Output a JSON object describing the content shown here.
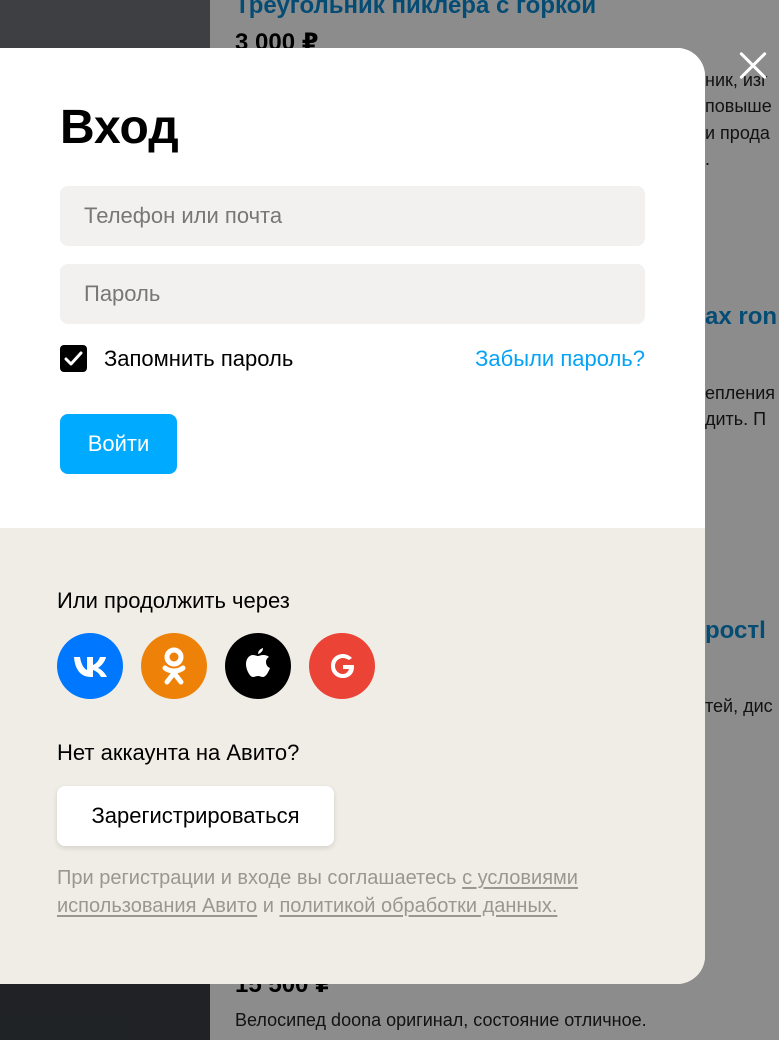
{
  "background": {
    "listing_top_title": "Треугольник пиклера с горкой",
    "listing_top_price": "3 000 ₽",
    "fragments": [
      "ник, изг",
      "повыше",
      "и прода",
      "."
    ],
    "listing2_title_fragment": "ax ron",
    "listing2_desc_fragments": [
      "епления",
      "дить. П"
    ],
    "listing3_title_fragment": "ростl",
    "listing3_desc_fragment": "тей, дис",
    "listing4_price": "15 500 ₽",
    "listing4_desc": "Велосипед doona оригинал, состояние отличное."
  },
  "modal": {
    "title": "Вход",
    "phone_placeholder": "Телефон или почта",
    "password_placeholder": "Пароль",
    "remember_checked": true,
    "remember_label": "Запомнить пароль",
    "forgot_link": "Забыли пароль?",
    "login_button": "Войти",
    "or_continue": "Или продолжить через",
    "social": [
      {
        "name": "vk",
        "icon": "vk-icon",
        "color": "#0077ff"
      },
      {
        "name": "ok",
        "icon": "odnoklassniki-icon",
        "color": "#ee8208"
      },
      {
        "name": "apple",
        "icon": "apple-icon",
        "color": "#000000"
      },
      {
        "name": "google",
        "icon": "google-icon",
        "color": "#eb4335"
      }
    ],
    "no_account": "Нет аккаунта на Авито?",
    "register_button": "Зарегистрироваться",
    "terms": {
      "prefix": "При регистрации и входе вы соглашаетесь ",
      "terms_link": "с условиями использования Авито",
      "middle": " и ",
      "privacy_link": "политикой обработки данных."
    }
  },
  "colors": {
    "accent": "#00aaff",
    "link": "#05a3f5",
    "bottom_panel": "#f0ede6"
  }
}
